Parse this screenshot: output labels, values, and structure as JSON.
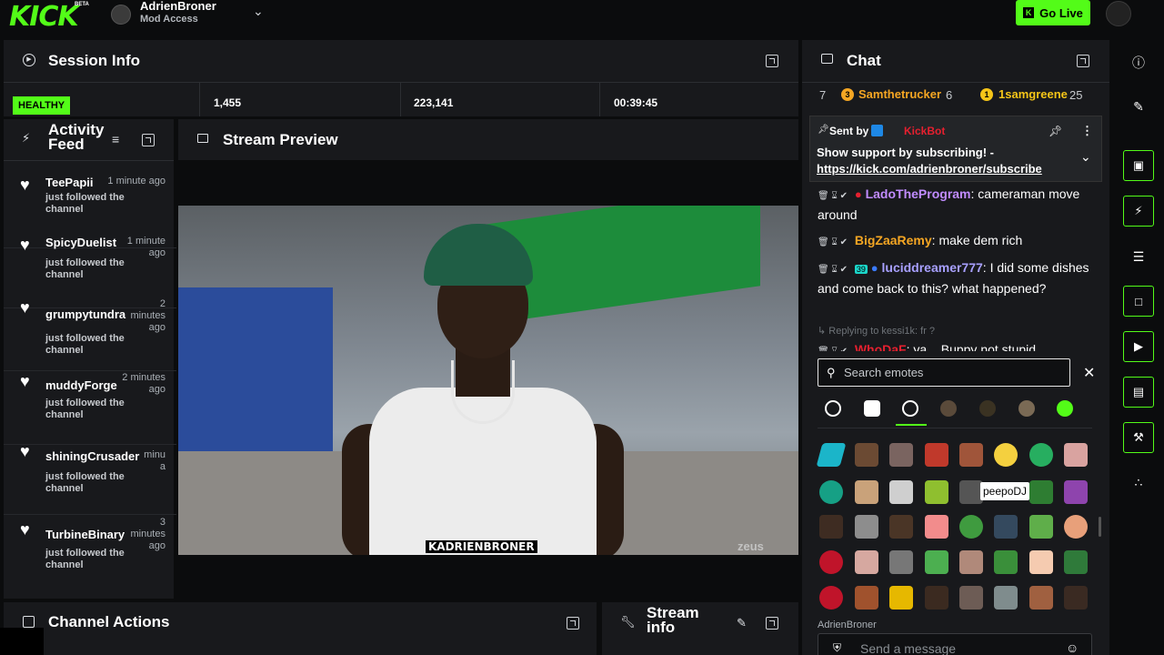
{
  "header": {
    "logo": "KICK",
    "beta": "BETA",
    "channel_name": "AdrienBroner",
    "channel_role": "Mod Access",
    "go_live_label": "Go Live"
  },
  "session_info": {
    "title": "Session Info",
    "health": "HEALTHY",
    "stats": [
      "1,455",
      "223,141",
      "00:39:45"
    ]
  },
  "activity_feed": {
    "title_line1": "Activity",
    "title_line2": "Feed",
    "items": [
      {
        "user": "TeePapii",
        "time": "1 minute ago",
        "text": "just followed the channel"
      },
      {
        "user": "SpicyDuelist",
        "time": "1 minute ago",
        "text": "just followed the channel"
      },
      {
        "user": "grumpytundra",
        "time": "2 minutes ago",
        "text": "just followed the channel"
      },
      {
        "user": "muddyForge",
        "time": "2 minutes ago",
        "text": "just followed the channel"
      },
      {
        "user": "shiningCrusader",
        "time": "minu a",
        "text": "just followed the channel"
      },
      {
        "user": "TurbineBinary",
        "time": "3 minutes ago",
        "text": "just followed the channel"
      }
    ]
  },
  "stream_preview": {
    "title": "Stream Preview",
    "caption": "KADRIENBRONER",
    "watermark": "zeus"
  },
  "channel_actions": {
    "title": "Channel Actions"
  },
  "stream_info": {
    "title_line1": "Stream",
    "title_line2": "info"
  },
  "chat": {
    "title": "Chat",
    "leaderboard": {
      "rank": "7",
      "user1": "Samthetrucker",
      "count1": "6",
      "user2": "1samgreene",
      "count2": "25"
    },
    "pinned": {
      "sent_by": "Sent by",
      "bot": "KickBot",
      "message": "Show support by subscribing! -",
      "link": "https://kick.com/adrienbroner/subscribe"
    },
    "messages": [
      {
        "user": "LadoTheProgram",
        "text": "cameraman move around",
        "color": "#c18cff"
      },
      {
        "user": "BigZaaRemy",
        "text": "make dem rich",
        "color": "#f5a623"
      },
      {
        "user": "luciddreamer777",
        "text": "I did some dishes and come back to this? what happened?",
        "color": "#a8a0ff"
      }
    ],
    "reply_hint": "Replying to kessi1k: fr ?",
    "partial_user": "WhoDaF",
    "partial_text": "ya... Buppy not stupid",
    "search_placeholder": "Search emotes",
    "tooltip": "peepoDJ",
    "input_label": "AdrienBroner",
    "input_placeholder": "Send a message"
  },
  "colors": {
    "accent": "#53fc18",
    "panel": "#18191c",
    "background": "#0b0c0d"
  },
  "icons": {
    "rail": [
      "info-icon",
      "pencil-icon",
      "stream-icon",
      "lightning-icon",
      "list-icon",
      "chat-icon",
      "play-icon",
      "save-icon",
      "wrench-icon",
      "people-icon"
    ]
  }
}
